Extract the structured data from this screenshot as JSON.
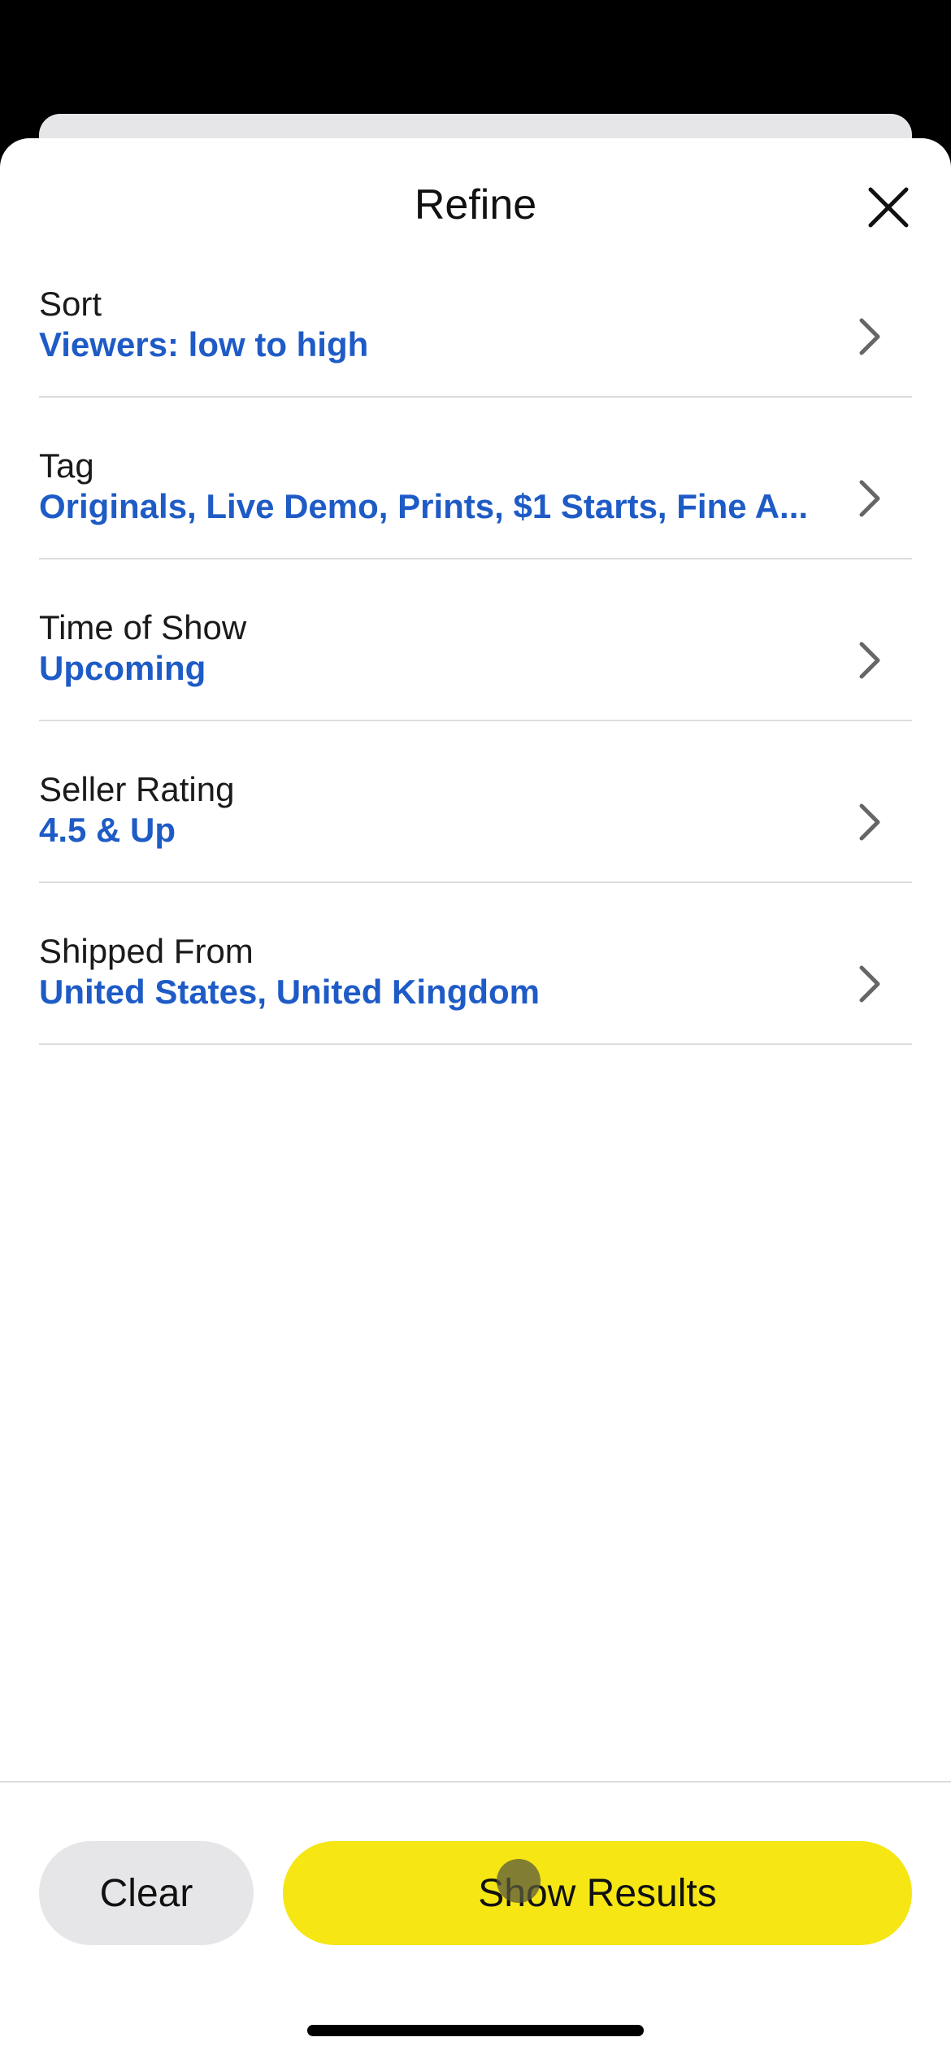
{
  "sheet": {
    "title": "Refine",
    "close_icon": "close-icon"
  },
  "filters": [
    {
      "label": "Sort",
      "value": "Viewers: low to high"
    },
    {
      "label": "Tag",
      "value": "Originals, Live Demo, Prints, $1 Starts, Fine A..."
    },
    {
      "label": "Time of Show",
      "value": "Upcoming"
    },
    {
      "label": "Seller Rating",
      "value": "4.5 & Up"
    },
    {
      "label": "Shipped From",
      "value": "United States, United Kingdom"
    }
  ],
  "footer": {
    "clear_label": "Clear",
    "show_results_label": "Show Results"
  },
  "colors": {
    "accent_blue": "#1e5bc6",
    "primary_yellow": "#f5e614",
    "secondary_gray": "#e6e6e8"
  }
}
